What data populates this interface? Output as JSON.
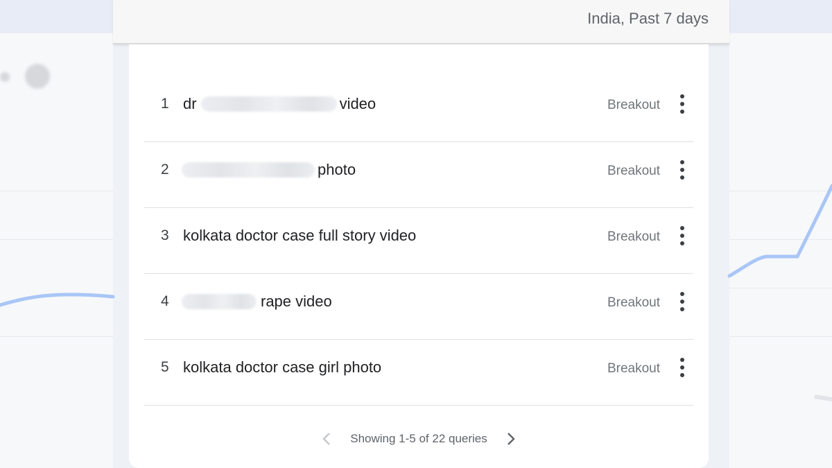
{
  "header": {
    "filter_text": "India, Past 7 days"
  },
  "queries": [
    {
      "index": "1",
      "prefix": "dr",
      "suffix": "video",
      "value": "Breakout"
    },
    {
      "index": "2",
      "prefix": "",
      "suffix": "photo",
      "value": "Breakout"
    },
    {
      "index": "3",
      "prefix": "",
      "suffix": "kolkata doctor case full story video",
      "value": "Breakout"
    },
    {
      "index": "4",
      "prefix": "",
      "suffix": "rape video",
      "value": "Breakout"
    },
    {
      "index": "5",
      "prefix": "",
      "suffix": "kolkata doctor case girl photo",
      "value": "Breakout"
    }
  ],
  "pagination": {
    "text": "Showing 1-5 of 22 queries"
  },
  "icons": {
    "row_menu": "more-vert-icon",
    "prev": "chevron-left-icon",
    "next": "chevron-right-icon"
  },
  "colors": {
    "trend_line": "#8ab4f8",
    "accent_gray": "#5f6368"
  }
}
